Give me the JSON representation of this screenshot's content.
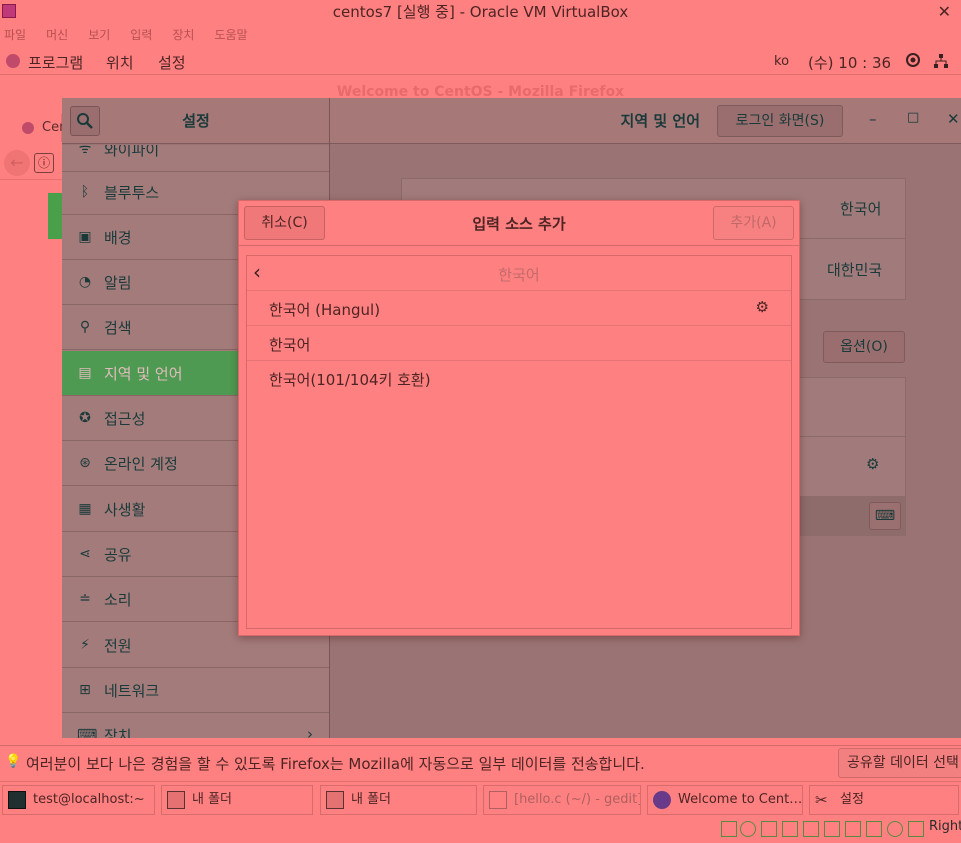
{
  "vbox": {
    "title": "centos7 [실행 중] - Oracle VM VirtualBox",
    "close_label": "✕",
    "menu": [
      "파일",
      "머신",
      "보기",
      "입력",
      "장치",
      "도움말"
    ]
  },
  "topbar": {
    "programs": "프로그램",
    "places": "위치",
    "settings": "설정",
    "lang": "ko",
    "clock": "(수) 10 : 36"
  },
  "firefox": {
    "title": "Welcome to CentOS - Mozilla Firefox",
    "tab_label": "Cen"
  },
  "settings": {
    "sidebar_title": "설정",
    "panel_title": "지역 및 언어",
    "login_screen_button": "로그인 화면(S)",
    "minimize": "–",
    "maximize": "□",
    "close": "✕",
    "sidebar_items": [
      {
        "icon": "wifi-icon",
        "glyph": "ᯤ",
        "label": "와이파이"
      },
      {
        "icon": "bluetooth-icon",
        "glyph": "ᛒ",
        "label": "블루투스"
      },
      {
        "icon": "background-icon",
        "glyph": "▣",
        "label": "배경"
      },
      {
        "icon": "notifications-icon",
        "glyph": "◔",
        "label": "알림"
      },
      {
        "icon": "search-icon",
        "glyph": "⚲",
        "label": "검색"
      },
      {
        "icon": "region-language-icon",
        "glyph": "▤",
        "label": "지역 및 언어"
      },
      {
        "icon": "accessibility-icon",
        "glyph": "✪",
        "label": "접근성"
      },
      {
        "icon": "online-accounts-icon",
        "glyph": "⊛",
        "label": "온라인 계정"
      },
      {
        "icon": "privacy-icon",
        "glyph": "▦",
        "label": "사생활"
      },
      {
        "icon": "sharing-icon",
        "glyph": "⋖",
        "label": "공유"
      },
      {
        "icon": "sound-icon",
        "glyph": "≐",
        "label": "소리"
      },
      {
        "icon": "power-icon",
        "glyph": "⚡",
        "label": "전원"
      },
      {
        "icon": "network-icon",
        "glyph": "⊞",
        "label": "네트워크"
      },
      {
        "icon": "devices-icon",
        "glyph": "⌨",
        "label": "장치"
      }
    ],
    "active_item": "지역 및 언어",
    "language_value": "한국어",
    "formats_value": "대한민국",
    "options_button": "옵션(O)"
  },
  "dialog": {
    "cancel": "취소(C)",
    "title": "입력 소스 추가",
    "add": "추가(A)",
    "back_label": "한국어",
    "rows": [
      "한국어 (Hangul)",
      "한국어",
      "한국어(101/104키 호환)"
    ]
  },
  "notification": {
    "text": "여러분이 보다 나은 경험을 할 수 있도록 Firefox는 Mozilla에 자동으로 일부 데이터를 전송합니다.",
    "share_button": "공유할 데이터 선택"
  },
  "taskbar": {
    "items": [
      {
        "icon": "terminal-icon",
        "label": "test@localhost:~"
      },
      {
        "icon": "folder-icon",
        "label": "내 폴더"
      },
      {
        "icon": "folder-icon",
        "label": "내 폴더"
      },
      {
        "icon": "gedit-icon",
        "label": "[hello.c (~/) - gedit]"
      },
      {
        "icon": "firefox-icon",
        "label": "Welcome to Cent…"
      },
      {
        "icon": "settings-tools-icon",
        "label": "설정"
      }
    ]
  },
  "tray": {
    "host_key": "Right"
  }
}
